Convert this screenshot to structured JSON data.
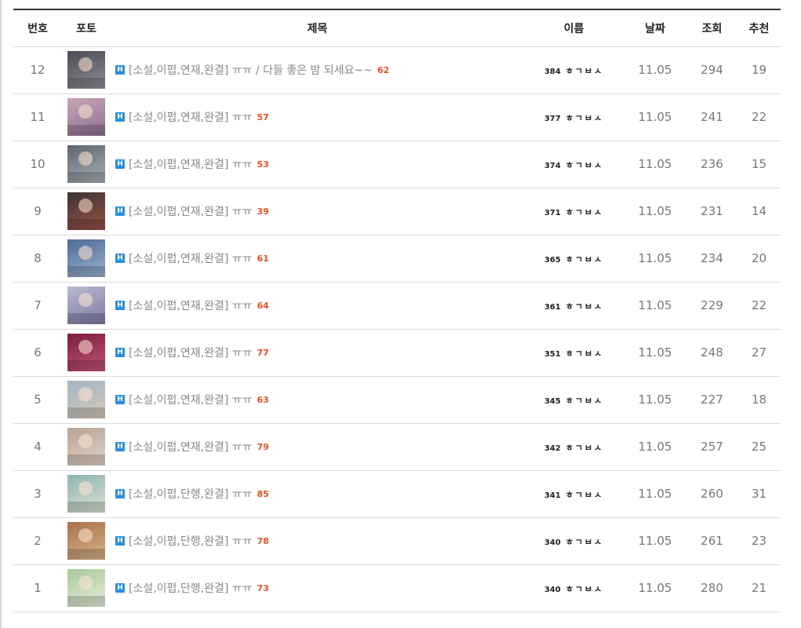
{
  "header": {
    "no": "번호",
    "photo": "포토",
    "subject": "제목",
    "name": "이름",
    "date": "날짜",
    "hit": "조회",
    "recommend": "추천"
  },
  "badge": "H",
  "rows": [
    {
      "no": "12",
      "title": "[소설,이펍,연재,완결] ㅠㅠ / 다들 좋은 밤 되세요~~",
      "comments": "62",
      "level": "384",
      "name": "ㅎㄱㅂㅅ",
      "date": "11.05",
      "hit": "294",
      "rec": "19",
      "thumb_colors": [
        "#4a4a55",
        "#8e8e96"
      ]
    },
    {
      "no": "11",
      "title": "[소설,이펍,연재,완결] ㅠㅠ",
      "comments": "57",
      "level": "377",
      "name": "ㅎㄱㅂㅅ",
      "date": "11.05",
      "hit": "241",
      "rec": "22",
      "thumb_colors": [
        "#c7a6b8",
        "#8a6f8f"
      ]
    },
    {
      "no": "10",
      "title": "[소설,이펍,연재,완결] ㅠㅠ",
      "comments": "53",
      "level": "374",
      "name": "ㅎㄱㅂㅅ",
      "date": "11.05",
      "hit": "236",
      "rec": "15",
      "thumb_colors": [
        "#5c6670",
        "#a7b0b7"
      ]
    },
    {
      "no": "9",
      "title": "[소설,이펍,연재,완결] ㅠㅠ",
      "comments": "39",
      "level": "371",
      "name": "ㅎㄱㅂㅅ",
      "date": "11.05",
      "hit": "231",
      "rec": "14",
      "thumb_colors": [
        "#3a3432",
        "#9b5248"
      ]
    },
    {
      "no": "8",
      "title": "[소설,이펍,연재,완결] ㅠㅠ",
      "comments": "61",
      "level": "365",
      "name": "ㅎㄱㅂㅅ",
      "date": "11.05",
      "hit": "234",
      "rec": "20",
      "thumb_colors": [
        "#4d6b96",
        "#9db0cf"
      ]
    },
    {
      "no": "7",
      "title": "[소설,이펍,연재,완결] ㅠㅠ",
      "comments": "64",
      "level": "361",
      "name": "ㅎㄱㅂㅅ",
      "date": "11.05",
      "hit": "229",
      "rec": "22",
      "thumb_colors": [
        "#b9b9cf",
        "#7c7aa3"
      ]
    },
    {
      "no": "6",
      "title": "[소설,이펍,연재,완결] ㅠㅠ",
      "comments": "77",
      "level": "351",
      "name": "ㅎㄱㅂㅅ",
      "date": "11.05",
      "hit": "248",
      "rec": "27",
      "thumb_colors": [
        "#7a1f3d",
        "#c25477"
      ]
    },
    {
      "no": "5",
      "title": "[소설,이펍,연재,완결] ㅠㅠ",
      "comments": "63",
      "level": "345",
      "name": "ㅎㄱㅂㅅ",
      "date": "11.05",
      "hit": "227",
      "rec": "18",
      "thumb_colors": [
        "#9fb6c8",
        "#d8c9b6"
      ]
    },
    {
      "no": "4",
      "title": "[소설,이펍,연재,완결] ㅠㅠ",
      "comments": "79",
      "level": "342",
      "name": "ㅎㄱㅂㅅ",
      "date": "11.05",
      "hit": "257",
      "rec": "25",
      "thumb_colors": [
        "#b8a396",
        "#e0d3c7"
      ]
    },
    {
      "no": "3",
      "title": "[소설,이펍,단행,완결] ㅠㅠ",
      "comments": "85",
      "level": "341",
      "name": "ㅎㄱㅂㅅ",
      "date": "11.05",
      "hit": "260",
      "rec": "31",
      "thumb_colors": [
        "#8fb3b0",
        "#d9e2d3"
      ]
    },
    {
      "no": "2",
      "title": "[소설,이펍,단행,완결] ㅠㅠ",
      "comments": "78",
      "level": "340",
      "name": "ㅎㄱㅂㅅ",
      "date": "11.05",
      "hit": "261",
      "rec": "23",
      "thumb_colors": [
        "#a9714a",
        "#d8b48b"
      ]
    },
    {
      "no": "1",
      "title": "[소설,이펍,단행,완결] ㅠㅠ",
      "comments": "73",
      "level": "340",
      "name": "ㅎㄱㅂㅅ",
      "date": "11.05",
      "hit": "280",
      "rec": "21",
      "thumb_colors": [
        "#a8c79e",
        "#e7eedb"
      ]
    }
  ]
}
